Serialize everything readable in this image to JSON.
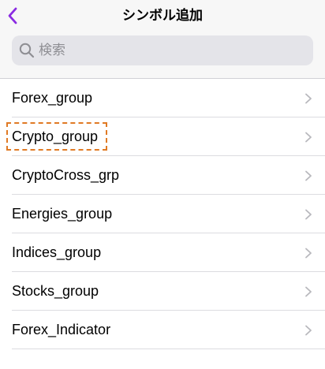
{
  "header": {
    "title": "シンボル追加",
    "back_icon": "chevron-left-icon",
    "accent_color": "#8a2be2"
  },
  "search": {
    "placeholder": "検索",
    "value": "",
    "icon": "search-icon"
  },
  "list": {
    "items": [
      {
        "label": "Forex_group"
      },
      {
        "label": "Crypto_group"
      },
      {
        "label": "CryptoCross_grp"
      },
      {
        "label": "Energies_group"
      },
      {
        "label": "Indices_group"
      },
      {
        "label": "Stocks_group"
      },
      {
        "label": "Forex_Indicator"
      }
    ],
    "highlighted_item": "Crypto_group",
    "highlight_color": "#e07a24"
  }
}
